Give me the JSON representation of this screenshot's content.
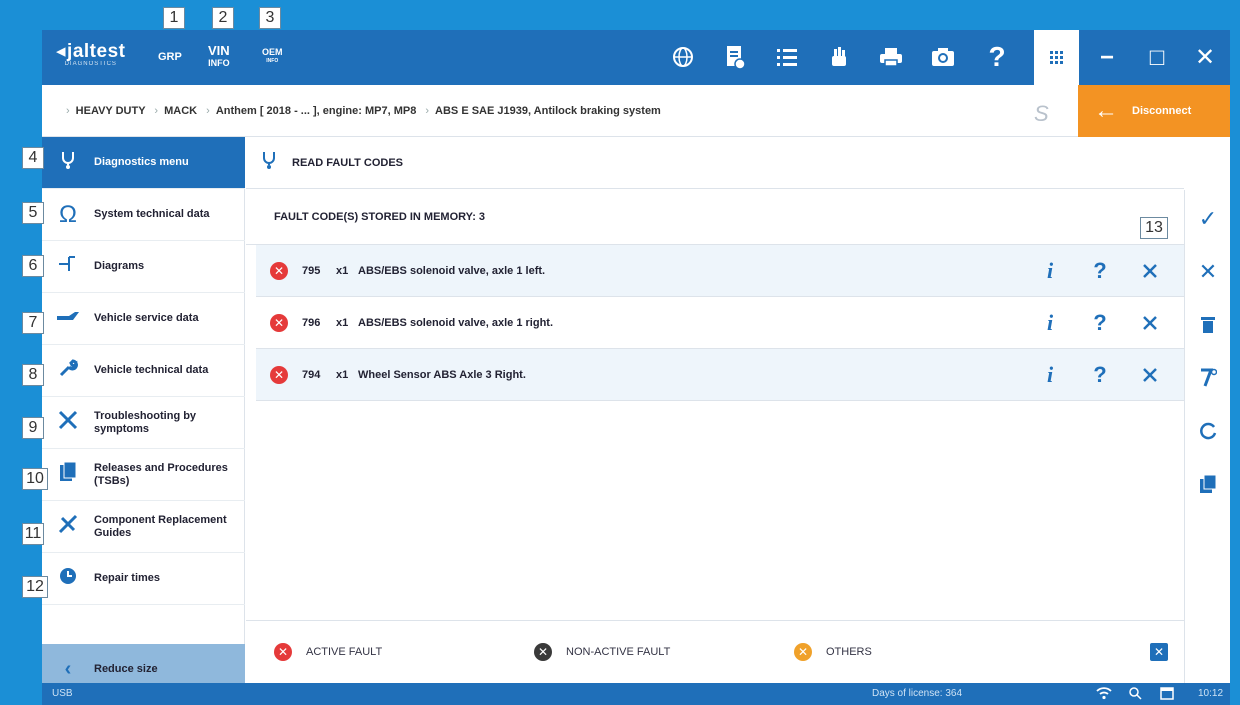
{
  "callouts": [
    "1",
    "2",
    "3",
    "4",
    "5",
    "6",
    "7",
    "8",
    "9",
    "10",
    "11",
    "12",
    "13"
  ],
  "topbar": {
    "logo": "jaltest",
    "logo_sub": "DIAGNOSTICS",
    "grp": "GRP",
    "vin_top": "VIN",
    "vin_bottom": "INFO",
    "oem_top": "OEM",
    "oem_bottom": "INFO",
    "icons": [
      "globe-icon",
      "document-icon",
      "list-icon",
      "hand-icon",
      "printer-icon",
      "camera-icon",
      "help-icon"
    ],
    "help": "?",
    "grid": "⋮⋮⋮",
    "minimize": "−",
    "maximize": "□",
    "close": "✕"
  },
  "breadcrumb": {
    "items": [
      "HEAVY DUTY",
      "MACK",
      "Anthem [ 2018 - ... ], engine: MP7, MP8",
      "ABS E SAE J1939, Antilock braking system"
    ],
    "disconnect": "Disconnect"
  },
  "sidebar": {
    "items": [
      {
        "label": "Diagnostics menu",
        "icon": "stethoscope-icon"
      },
      {
        "label": "System technical data",
        "icon": "omega-icon"
      },
      {
        "label": "Diagrams",
        "icon": "diagram-icon"
      },
      {
        "label": "Vehicle service data",
        "icon": "oil-can-icon"
      },
      {
        "label": "Vehicle technical data",
        "icon": "wrench-icon"
      },
      {
        "label": "Troubleshooting by symptoms",
        "icon": "tools-icon"
      },
      {
        "label": "Releases and Procedures (TSBs)",
        "icon": "documents-icon"
      },
      {
        "label": "Component Replacement Guides",
        "icon": "replace-tools-icon"
      },
      {
        "label": "Repair times",
        "icon": "clock-gear-icon"
      }
    ],
    "reduce": "Reduce size"
  },
  "main": {
    "title": "READ FAULT CODES",
    "stored": "FAULT CODE(S) STORED IN MEMORY: 3",
    "faults": [
      {
        "code": "795",
        "count": "x1",
        "desc": "ABS/EBS solenoid valve, axle 1 left."
      },
      {
        "code": "796",
        "count": "x1",
        "desc": "ABS/EBS solenoid valve, axle 1 right."
      },
      {
        "code": "794",
        "count": "x1",
        "desc": "Wheel Sensor ABS Axle 3 Right."
      }
    ],
    "info": "i",
    "help": "?"
  },
  "legend": {
    "active": "ACTIVE FAULT",
    "nonactive": "NON-ACTIVE FAULT",
    "others": "OTHERS",
    "colors": {
      "active": "#e53a3a",
      "nonactive": "#3a3a3a",
      "others": "#f0a12a"
    }
  },
  "status": {
    "usb": "USB",
    "license": "Days of license: 364",
    "time": "10:12"
  }
}
